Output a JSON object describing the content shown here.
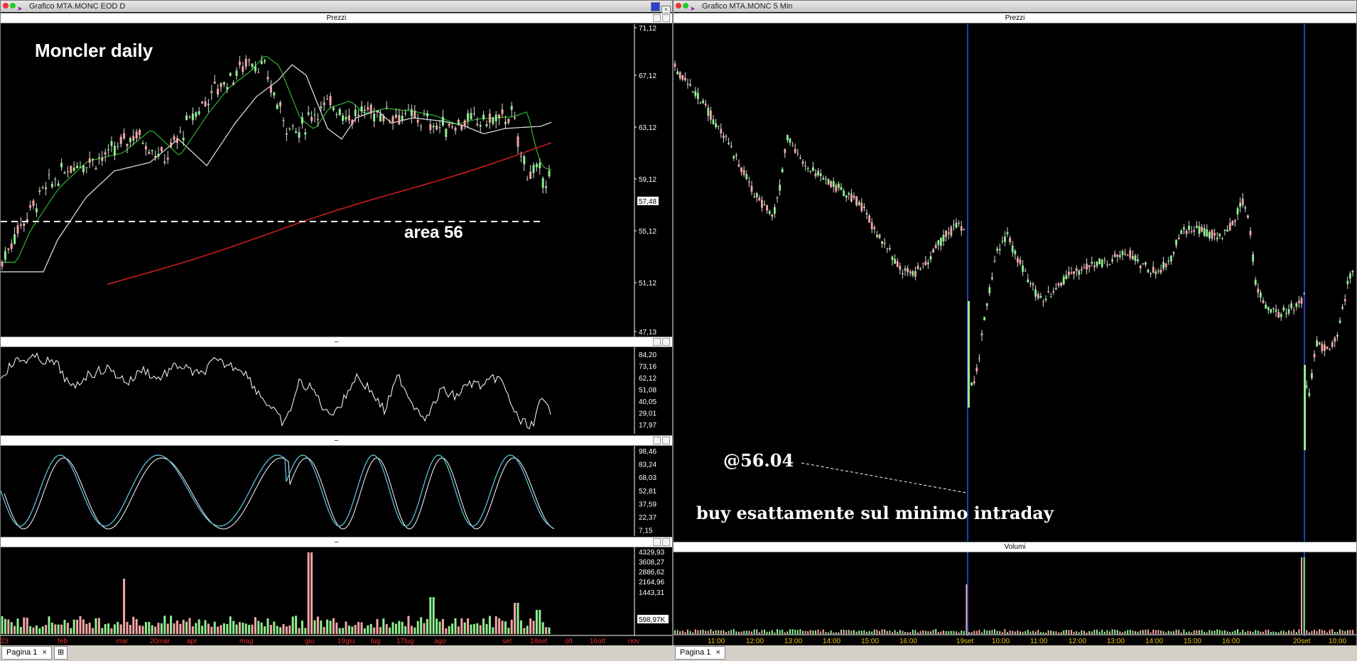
{
  "left_window": {
    "title": "Grafico MTA.MONC EOD D",
    "price_pane_label": "Prezzi",
    "annotation_title": "Moncler daily",
    "annotation_level": "area 56",
    "price_axis": [
      "71,12",
      "67,12",
      "63,12",
      "59,12",
      "57,48",
      "55,12",
      "51,12",
      "47,13"
    ],
    "rsi_axis": [
      "84,20",
      "73,16",
      "62,12",
      "51,08",
      "40,05",
      "29,01",
      "17,97"
    ],
    "stoch_axis": [
      "98,46",
      "83,24",
      "68,03",
      "52,81",
      "37,59",
      "22,37",
      "7,15"
    ],
    "volume_axis": [
      "4329,93",
      "3608,27",
      "2886,62",
      "2164,96",
      "1443,31",
      "598,97K"
    ],
    "pane_separator_label": "–",
    "date_axis": [
      "23",
      "feb",
      "mar",
      "20mar",
      "apr",
      "mag",
      "giu",
      "19giu",
      "lug",
      "17lug",
      "ago",
      "set",
      "18set",
      "ott",
      "16ott",
      "nov"
    ],
    "tab_label": "Pagina 1"
  },
  "right_window": {
    "title": "Grafico MTA.MONC 5 Min",
    "price_pane_label": "Prezzi",
    "volume_pane_label": "Volumi",
    "annotation_price": "@56.04",
    "annotation_text": "buy esattamente sul minimo intraday",
    "time_axis": [
      "11:00",
      "12:00",
      "13:00",
      "14:00",
      "15:00",
      "16:00",
      "19set",
      "10:00",
      "11:00",
      "12:00",
      "13:00",
      "14:00",
      "15:00",
      "16:00",
      "20set",
      "10:00"
    ],
    "tab_label": "Pagina 1"
  },
  "colors": {
    "background": "#000000",
    "candle_up": "#90ee90",
    "candle_down": "#f4a6a6",
    "ma_short": "#2db52d",
    "ma_mid": "#e8e8e8",
    "ma_long": "#d02020",
    "stoch_k": "#5ccfe6",
    "session_line": "#1f3fbf"
  }
}
